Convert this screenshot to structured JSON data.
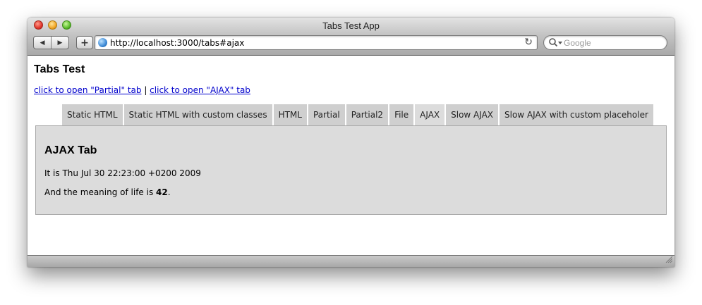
{
  "window": {
    "title": "Tabs Test App"
  },
  "toolbar": {
    "back_icon": "back-arrow-icon",
    "forward_icon": "forward-arrow-icon",
    "add_label": "+",
    "url": "http://localhost:3000/tabs#ajax",
    "search_placeholder": "Google"
  },
  "page": {
    "title": "Tabs Test",
    "link_partial": "click to open \"Partial\" tab",
    "link_separator": " | ",
    "link_ajax": "click to open \"AJAX\" tab"
  },
  "tabs": [
    {
      "label": "Static HTML",
      "active": false
    },
    {
      "label": "Static HTML with custom classes",
      "active": false
    },
    {
      "label": "HTML",
      "active": false
    },
    {
      "label": "Partial",
      "active": false
    },
    {
      "label": "Partial2",
      "active": false
    },
    {
      "label": "File",
      "active": false
    },
    {
      "label": "AJAX",
      "active": true
    },
    {
      "label": "Slow AJAX",
      "active": false
    },
    {
      "label": "Slow AJAX with custom placeholer",
      "active": false
    }
  ],
  "panel": {
    "title": "AJAX Tab",
    "line1": "It is Thu Jul 30 22:23:00 +0200 2009",
    "line2_prefix": "And the meaning of life is ",
    "line2_value": "42",
    "line2_suffix": "."
  },
  "colors": {
    "link": "#0000cc",
    "tab_background": "#cfcfcf",
    "panel_background": "#dcdcdc"
  }
}
